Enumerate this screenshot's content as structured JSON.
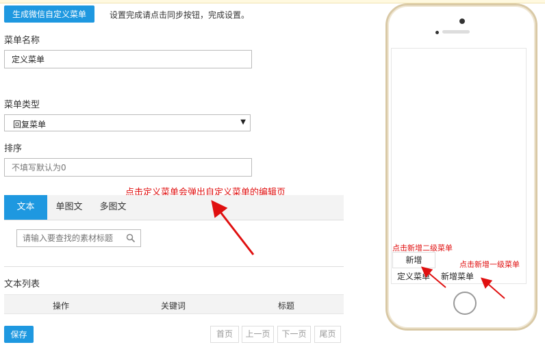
{
  "header": {
    "generate_button": "生成微信自定义菜单",
    "hint": "设置完成请点击同步按钮，完成设置。"
  },
  "form": {
    "menu_name_label": "菜单名称",
    "menu_name_value": "定义菜单",
    "menu_type_label": "菜单类型",
    "menu_type_value": "回复菜单",
    "sort_label": "排序",
    "sort_placeholder": "不填写默认为0"
  },
  "annotation_main": "点击定义菜单会弹出自定义菜单的编辑页",
  "tabs": [
    {
      "label": "文本",
      "active": true
    },
    {
      "label": "单图文",
      "active": false
    },
    {
      "label": "多图文",
      "active": false
    }
  ],
  "search": {
    "placeholder": "请输入要查找的素材标题",
    "icon": "search-icon"
  },
  "list": {
    "title": "文本列表",
    "columns": [
      "操作",
      "关键词",
      "标题"
    ]
  },
  "save_button": "保存",
  "pagination": [
    "首页",
    "上一页",
    "下一页",
    "尾页"
  ],
  "phone": {
    "submenu_add": "新增",
    "menu_items": [
      "定义菜单",
      "新增菜单"
    ],
    "annotation_submenu": "点击新增二级菜单",
    "annotation_menu": "点击新增一级菜单"
  },
  "colors": {
    "accent": "#1e98e0",
    "annotation": "#e01010",
    "phone_frame": "#d9c9a6"
  }
}
